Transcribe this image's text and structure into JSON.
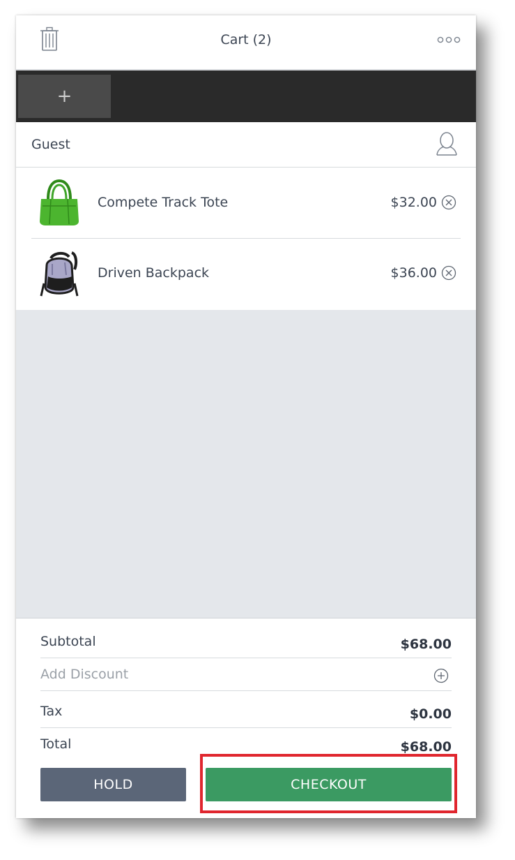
{
  "header": {
    "title": "Cart (2)",
    "trash_icon": "trash-icon",
    "more_icon": "more-dots-icon"
  },
  "tabs": {
    "add_label": "+"
  },
  "customer": {
    "label": "Guest",
    "icon": "customer-account-icon"
  },
  "items": [
    {
      "name": "Compete Track Tote",
      "price": "$32.00",
      "image": "green-tote-bag",
      "remove_icon": "remove-circle-icon"
    },
    {
      "name": "Driven Backpack",
      "price": "$36.00",
      "image": "grey-backpack",
      "remove_icon": "remove-circle-icon"
    }
  ],
  "totals": {
    "subtotal_label": "Subtotal",
    "subtotal_value": "$68.00",
    "discount_label": "Add Discount",
    "discount_icon": "plus-circle-icon",
    "tax_label": "Tax",
    "tax_value": "$0.00",
    "total_label": "Total",
    "total_value": "$68.00"
  },
  "actions": {
    "hold_label": "HOLD",
    "checkout_label": "CHECKOUT"
  },
  "colors": {
    "checkout": "#3b9a62",
    "hold": "#5b6678",
    "highlight": "#e0262e",
    "tabbar": "#2a2a2a",
    "empty_area": "#e4e7eb"
  }
}
